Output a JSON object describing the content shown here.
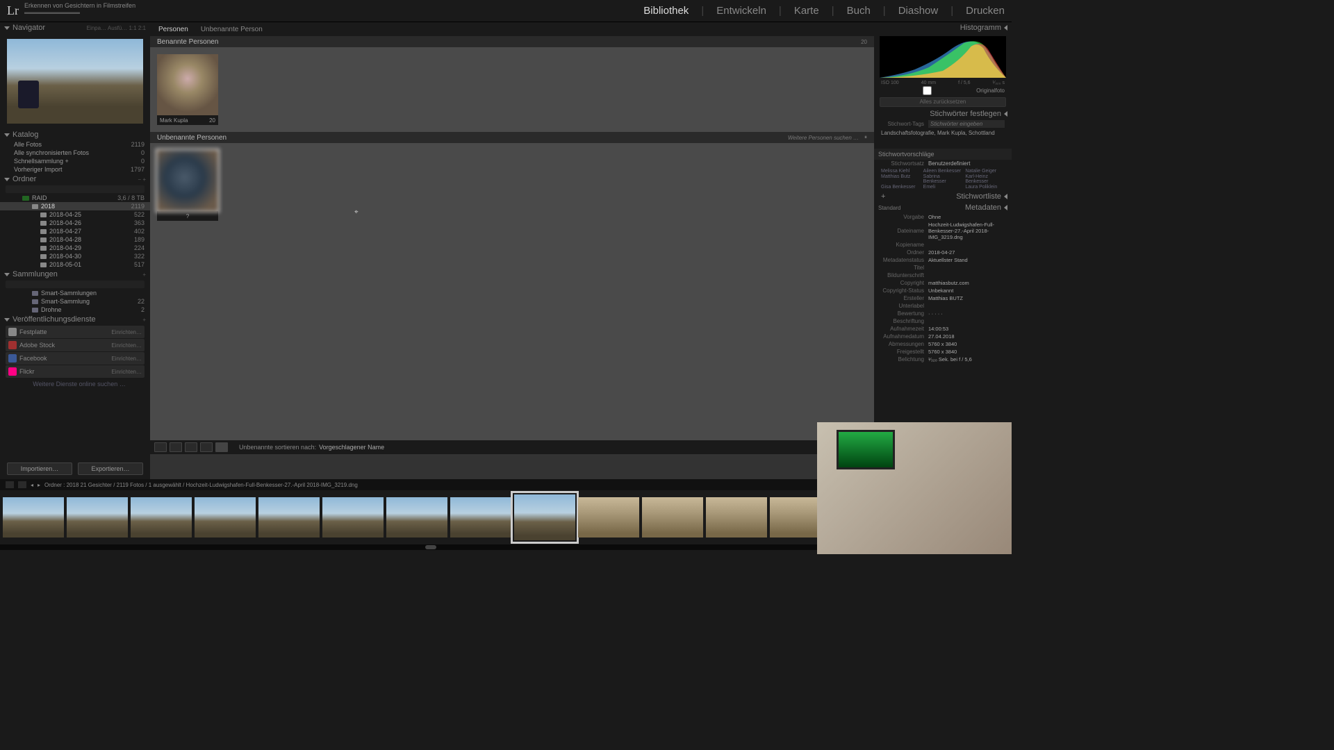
{
  "app": {
    "logo": "Lr",
    "title": "Erkennen von Gesichtern in Filmstreifen"
  },
  "modules": [
    "Bibliothek",
    "Entwickeln",
    "Karte",
    "Buch",
    "Diashow",
    "Drucken"
  ],
  "module_active": "Bibliothek",
  "nav": {
    "title": "Navigator",
    "modes": "Einpa…  Ausfü…  1:1  2:1"
  },
  "catalog": {
    "title": "Katalog",
    "rows": [
      {
        "label": "Alle Fotos",
        "count": "2119"
      },
      {
        "label": "Alle synchronisierten Fotos",
        "count": "0"
      },
      {
        "label": "Schnellsammlung  +",
        "count": "0"
      },
      {
        "label": "Vorheriger Import",
        "count": "1797"
      }
    ]
  },
  "folders": {
    "title": "Ordner",
    "volume": {
      "name": "RAID",
      "stat": "3,6 / 8 TB"
    },
    "year": {
      "name": "2018",
      "count": "2119"
    },
    "dates": [
      {
        "name": "2018-04-25",
        "count": "522"
      },
      {
        "name": "2018-04-26",
        "count": "363"
      },
      {
        "name": "2018-04-27",
        "count": "402"
      },
      {
        "name": "2018-04-28",
        "count": "189"
      },
      {
        "name": "2018-04-29",
        "count": "224"
      },
      {
        "name": "2018-04-30",
        "count": "322"
      },
      {
        "name": "2018-05-01",
        "count": "517"
      }
    ]
  },
  "collections": {
    "title": "Sammlungen",
    "rows": [
      {
        "label": "Smart-Sammlungen",
        "count": ""
      },
      {
        "label": "Smart-Sammlung",
        "count": "22"
      },
      {
        "label": "Drohne",
        "count": "2"
      }
    ]
  },
  "publish": {
    "title": "Veröffentlichungsdienste",
    "rows": [
      {
        "label": "Festplatte",
        "setup": "Einrichten…",
        "color": "#888"
      },
      {
        "label": "Adobe Stock",
        "setup": "Einrichten…",
        "color": "#a03030"
      },
      {
        "label": "Facebook",
        "setup": "Einrichten…",
        "color": "#3b5998"
      },
      {
        "label": "Flickr",
        "setup": "Einrichten…",
        "color": "#ff0084"
      }
    ],
    "more": "Weitere Dienste online suchen …"
  },
  "btns": {
    "import": "Importieren…",
    "export": "Exportieren…"
  },
  "center": {
    "crumb": [
      "Personen",
      "Unbenannte Person"
    ],
    "named_hdr": "Benannte Personen",
    "named_cnt": "20",
    "named_face": {
      "name": "Mark Kupla",
      "cnt": "20"
    },
    "unnamed_hdr": "Unbenannte Personen",
    "unnamed_more": "Weitere Personen suchen …",
    "unnamed_face": {
      "name": "?",
      "cnt": ""
    },
    "sort_label": "Unbenannte sortieren nach:",
    "sort_val": "Vorgeschlagener Name"
  },
  "right": {
    "histo_title": "Histogramm",
    "histo_sub": [
      "ISO 100",
      "40 mm",
      "f / 5,6",
      "¹⁄₃₂₀ s"
    ],
    "orig": "Originalfoto",
    "reset": "Alles zurücksetzen",
    "kw_set": "Stichwörter festlegen",
    "kw_tags_lbl": "Stichwort-Tags",
    "kw_tags_ph": "Stichwörter eingeben",
    "kw_tags_val": "Landschaftsfotografie, Mark Kupla, Schottland",
    "kw_sug_title": "Stichwortvorschläge",
    "kw_set_lbl": "Stichwortsatz",
    "kw_set_val": "Benutzerdefiniert",
    "kw_sug": [
      "Melissa Kiehl",
      "Aileen Benkesser",
      "Natalie Geiger",
      "Matthias Butz",
      "Sabrina Benkesser",
      "Karl-Heinz Benkesser",
      "Gisa Benkesser",
      "Emeli",
      "Laura Poliklein"
    ],
    "kw_list": "Stichwortliste",
    "meta_title": "Metadaten",
    "meta_preset": "Standard",
    "meta": [
      {
        "lbl": "Vorgabe",
        "val": "Ohne"
      },
      {
        "lbl": "Dateiname",
        "val": "Hochzeit-Ludwigshafen-Full-Benkesser-27.-April 2018-IMG_3219.dng"
      },
      {
        "lbl": "Kopiename",
        "val": ""
      },
      {
        "lbl": "Ordner",
        "val": "2018-04-27"
      },
      {
        "lbl": "Metadatenstatus",
        "val": "Aktuellster Stand"
      },
      {
        "lbl": "Titel",
        "val": ""
      },
      {
        "lbl": "Bildunterschrift",
        "val": ""
      },
      {
        "lbl": "Copyright",
        "val": "matthiasbutz.com"
      },
      {
        "lbl": "Copyright-Status",
        "val": "Unbekannt"
      },
      {
        "lbl": "Ersteller",
        "val": "Matthias BUTZ"
      },
      {
        "lbl": "Unterlabel",
        "val": ""
      },
      {
        "lbl": "Bewertung",
        "val": "· · · · ·"
      },
      {
        "lbl": "Beschriftung",
        "val": ""
      },
      {
        "lbl": "Aufnahmezeit",
        "val": "14:00:53"
      },
      {
        "lbl": "Aufnahmedatum",
        "val": "27.04.2018"
      },
      {
        "lbl": "Abmessungen",
        "val": "5760 x 3840"
      },
      {
        "lbl": "Freigestellt",
        "val": "5760 x 3840"
      },
      {
        "lbl": "Belichtung",
        "val": "¹⁄₃₂₀ Sek. bei f / 5,6"
      }
    ]
  },
  "status": {
    "path": "Ordner : 2018   21 Gesichter / 2119 Fotos / 1 ausgewählt / Hochzeit-Ludwigshafen-Full-Benkesser-27.-April 2018-IMG_3219.dng"
  }
}
